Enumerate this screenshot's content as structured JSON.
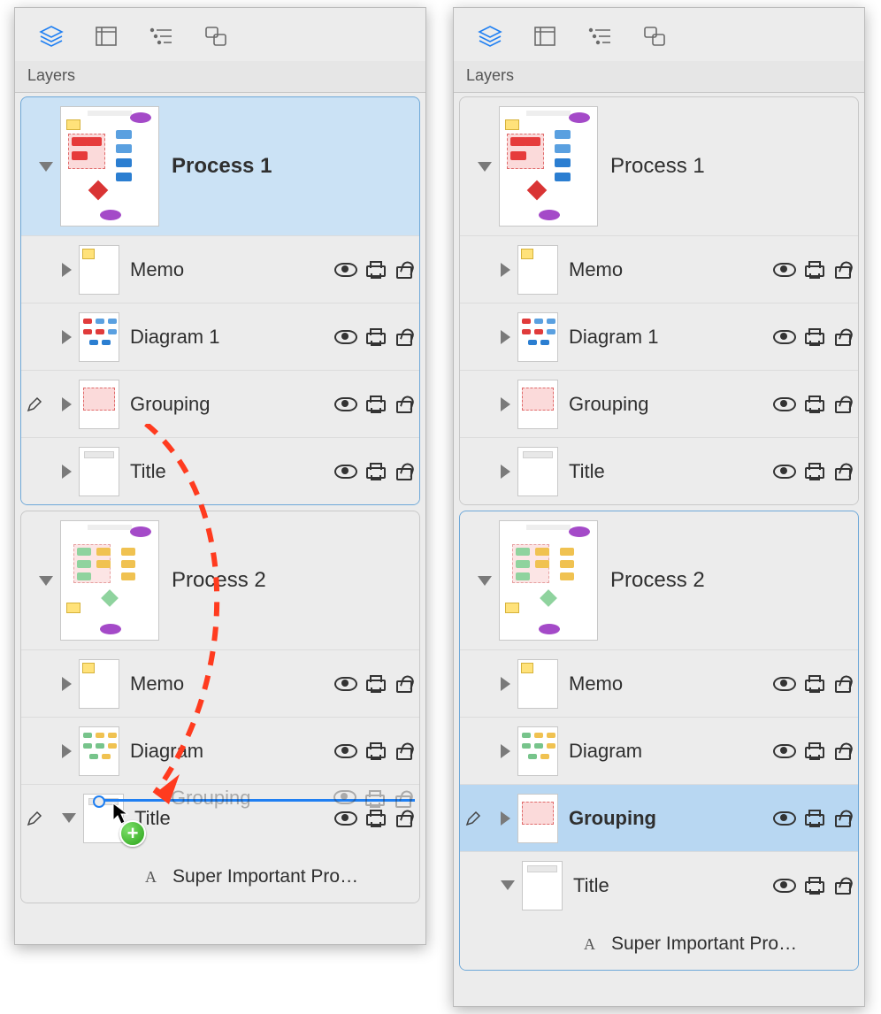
{
  "header": {
    "title": "Layers"
  },
  "left": {
    "canvas1": {
      "label": "Process 1",
      "selected": true,
      "layers": {
        "memo": "Memo",
        "diagram": "Diagram 1",
        "grouping": "Grouping",
        "title": "Title"
      }
    },
    "canvas2": {
      "label": "Process 2",
      "selected": false,
      "layers": {
        "memo": "Memo",
        "diagram": "Diagram",
        "title": "Title"
      },
      "drag_ghost": "Grouping",
      "text_item": "Super Important Pro…"
    }
  },
  "right": {
    "canvas1": {
      "label": "Process 1",
      "selected": false,
      "layers": {
        "memo": "Memo",
        "diagram": "Diagram 1",
        "grouping": "Grouping",
        "title": "Title"
      }
    },
    "canvas2": {
      "label": "Process 2",
      "selected": true,
      "layers": {
        "memo": "Memo",
        "diagram": "Diagram",
        "grouping": "Grouping",
        "title": "Title"
      },
      "text_item": "Super Important Pro…"
    }
  }
}
